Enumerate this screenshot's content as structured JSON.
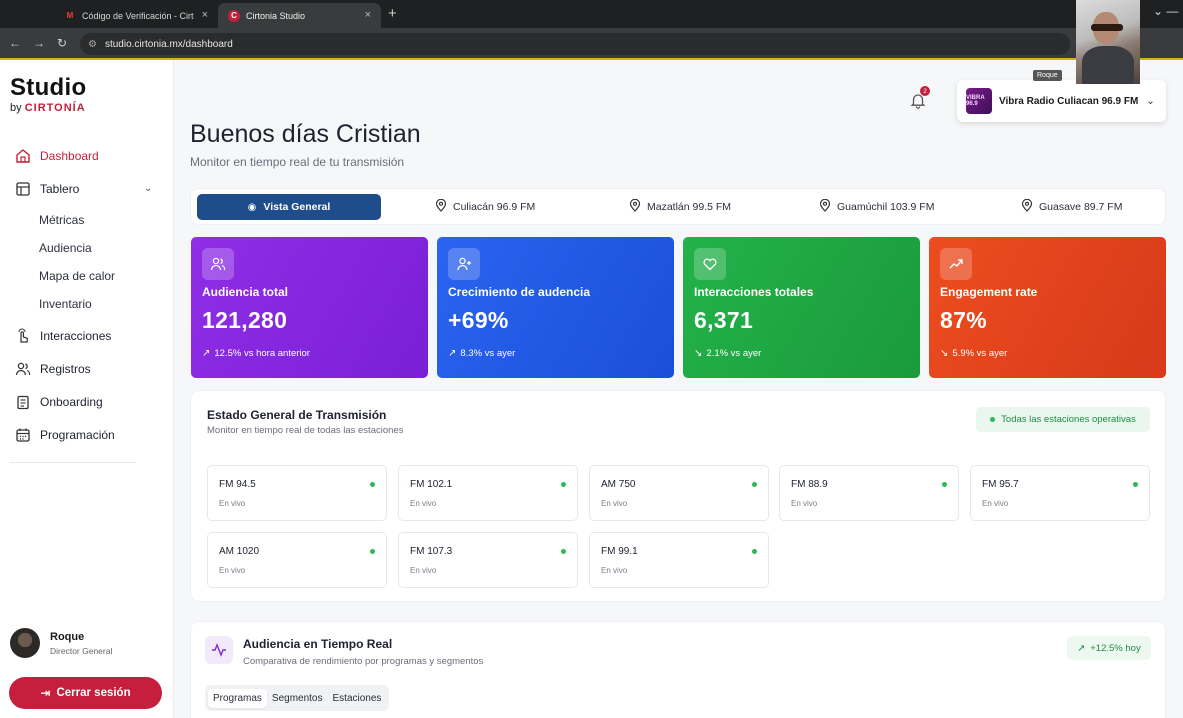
{
  "browser": {
    "tabs": [
      {
        "title": "Código de Verificación - Cirto",
        "favicon": "gmail-icon"
      },
      {
        "title": "Cirtonia Studio",
        "favicon": "cirtonia-icon"
      }
    ],
    "url": "studio.cirtonia.mx/dashboard"
  },
  "webcam": {
    "label": "Roque"
  },
  "brand": {
    "name": "Studio",
    "by": "by",
    "company": "CIRTONÍA",
    "accent": "#c51f3d"
  },
  "sidebar": {
    "items": [
      {
        "label": "Dashboard",
        "icon": "home-icon",
        "active": true
      },
      {
        "label": "Tablero",
        "icon": "layout-icon"
      },
      {
        "label": "Métricas"
      },
      {
        "label": "Audiencia"
      },
      {
        "label": "Mapa de calor"
      },
      {
        "label": "Inventario"
      },
      {
        "label": "Interacciones",
        "icon": "pointer-icon"
      },
      {
        "label": "Registros",
        "icon": "users-icon"
      },
      {
        "label": "Onboarding",
        "icon": "clipboard-icon"
      },
      {
        "label": "Programación",
        "icon": "calendar-icon"
      }
    ],
    "user": {
      "name": "Roque",
      "role": "Director General"
    },
    "logout_label": "Cerrar sesión"
  },
  "header": {
    "notifications_count": "2",
    "station": {
      "name": "Vibra Radio Culiacan 96.9 FM",
      "logo_text": "VIBRA 96.9"
    },
    "greeting": "Buenos días Cristian",
    "subtitle": "Monitor en tiempo real de tu transmisión"
  },
  "location_tabs": [
    {
      "label": "Vista General",
      "active": true
    },
    {
      "label": "Culiacán 96.9 FM"
    },
    {
      "label": "Mazatlán 99.5 FM"
    },
    {
      "label": "Guamúchil 103.9 FM"
    },
    {
      "label": "Guasave 89.7 FM"
    }
  ],
  "kpis": [
    {
      "label": "Audiencia total",
      "value": "121,280",
      "delta": "12.5% vs hora anterior",
      "trend": "up",
      "color": "#8a2be2"
    },
    {
      "label": "Crecimiento de audencia",
      "value": "+69%",
      "delta": "8.3% vs ayer",
      "trend": "up",
      "color": "#2b64f0"
    },
    {
      "label": "Interacciones totales",
      "value": "6,371",
      "delta": "2.1% vs ayer",
      "trend": "down",
      "color": "#23b24a"
    },
    {
      "label": "Engagement rate",
      "value": "87%",
      "delta": "5.9% vs ayer",
      "trend": "down",
      "color": "#ec4d1f"
    }
  ],
  "transmission": {
    "title": "Estado General de Transmisión",
    "subtitle": "Monitor en tiempo real de todas las estaciones",
    "status_badge": "Todas las estaciones operativas",
    "stations": [
      {
        "name": "FM 94.5",
        "status": "En vivo"
      },
      {
        "name": "FM 102.1",
        "status": "En vivo"
      },
      {
        "name": "AM 750",
        "status": "En vivo"
      },
      {
        "name": "FM 88.9",
        "status": "En vivo"
      },
      {
        "name": "FM 95.7",
        "status": "En vivo"
      },
      {
        "name": "AM 1020",
        "status": "En vivo"
      },
      {
        "name": "FM 107.3",
        "status": "En vivo"
      },
      {
        "name": "FM 99.1",
        "status": "En vivo"
      }
    ]
  },
  "audience_panel": {
    "title": "Audiencia en Tiempo Real",
    "subtitle": "Comparativa de rendimiento por programas y segmentos",
    "badge": "+12.5% hoy",
    "tabs": [
      {
        "label": "Programas",
        "active": true
      },
      {
        "label": "Segmentos"
      },
      {
        "label": "Estaciones"
      }
    ]
  }
}
